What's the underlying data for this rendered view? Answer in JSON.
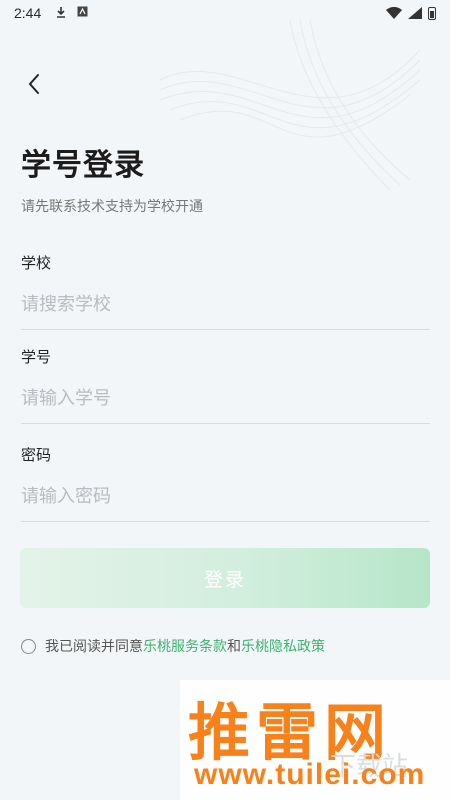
{
  "status_bar": {
    "time": "2:44"
  },
  "page": {
    "title": "学号登录",
    "subtitle": "请先联系技术支持为学校开通"
  },
  "form": {
    "school_label": "学校",
    "school_placeholder": "请搜索学校",
    "student_id_label": "学号",
    "student_id_placeholder": "请输入学号",
    "password_label": "密码",
    "password_placeholder": "请输入密码",
    "login_button": "登录"
  },
  "agreement": {
    "prefix": "我已阅读并同意",
    "terms_link": "乐桃服务条款",
    "conjunction": "和",
    "privacy_link": "乐桃隐私政策"
  },
  "watermark": {
    "brand": "推雷网",
    "url": "www.tuilei.com",
    "ghost_text": "下载站"
  },
  "colors": {
    "accent": "#3cb371",
    "login_gradient_end": "#b6e6c9",
    "background": "#f3f6f8",
    "watermark": "#f7821b"
  },
  "icons": {
    "back": "chevron-left-icon",
    "download": "download-icon",
    "notification": "app-notification-icon",
    "wifi": "wifi-icon",
    "signal": "signal-icon",
    "battery": "battery-icon"
  }
}
